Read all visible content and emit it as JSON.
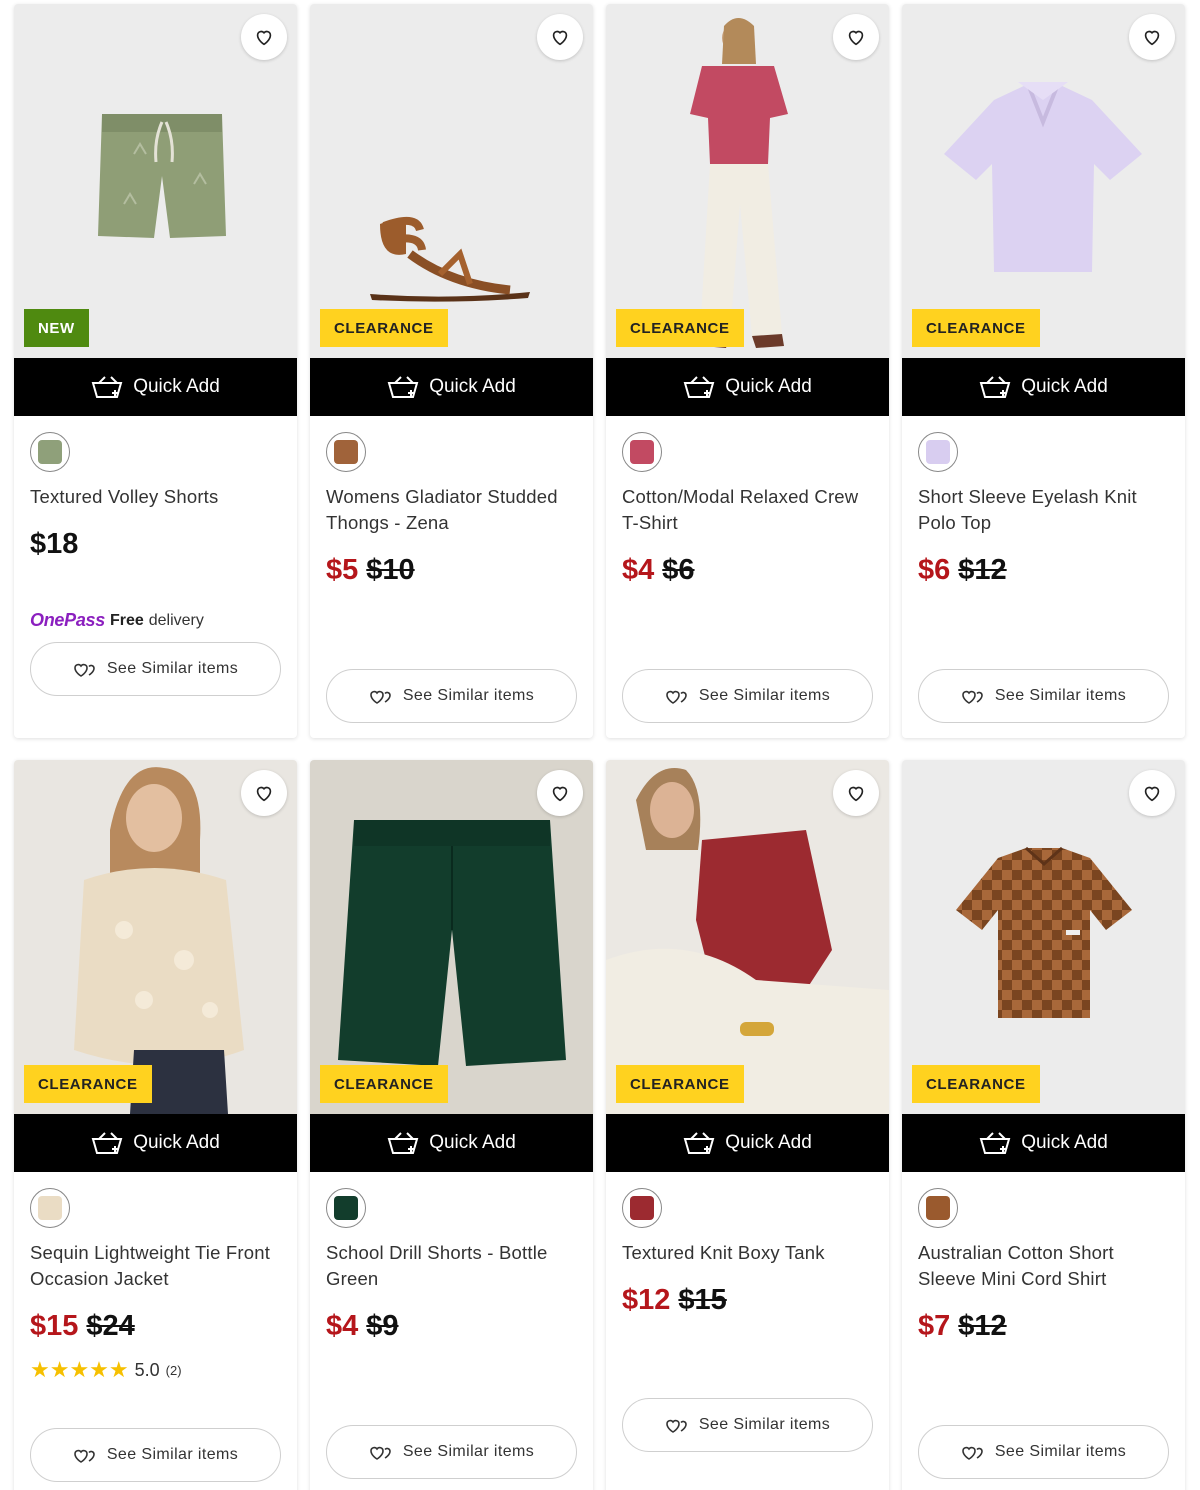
{
  "theme": {
    "sale_red": "#b5161b",
    "new_badge_bg": "#4f8a10",
    "clearance_badge_bg": "#ffd21f",
    "quick_add_bg": "#000000",
    "onepass_purple": "#8b1fbf",
    "star_color": "#f6c000"
  },
  "common": {
    "quick_add_label": "Quick Add",
    "see_similar_label": "See Similar items",
    "wishlist_icon": "heart-outline-icon",
    "quick_add_icon": "basket-plus-icon",
    "see_similar_icon": "hearts-icon"
  },
  "products": [
    {
      "title": "Textured Volley Shorts",
      "badge": "NEW",
      "price": "$18",
      "was_price": "",
      "swatch_color": "#8fa07a",
      "onepass": {
        "brand": "OnePass",
        "free": "Free",
        "delivery": "delivery"
      }
    },
    {
      "title": "Womens Gladiator Studded Thongs - Zena",
      "badge": "CLEARANCE",
      "price": "$5",
      "was_price": "$10",
      "swatch_color": "#a0633a"
    },
    {
      "title": "Cotton/Modal Relaxed Crew T-Shirt",
      "badge": "CLEARANCE",
      "price": "$4",
      "was_price": "$6",
      "swatch_color": "#c24a62"
    },
    {
      "title": "Short Sleeve Eyelash Knit Polo Top",
      "badge": "CLEARANCE",
      "price": "$6",
      "was_price": "$12",
      "swatch_color": "#d8cdf0"
    },
    {
      "title": "Sequin Lightweight Tie Front Occasion Jacket",
      "badge": "CLEARANCE",
      "price": "$15",
      "was_price": "$24",
      "swatch_color": "#eadcc4",
      "rating": {
        "stars": 5,
        "score": "5.0",
        "count": "(2)"
      }
    },
    {
      "title": "School Drill Shorts - Bottle Green",
      "badge": "CLEARANCE",
      "price": "$4",
      "was_price": "$9",
      "swatch_color": "#123d2c"
    },
    {
      "title": "Textured Knit Boxy Tank",
      "badge": "CLEARANCE",
      "price": "$12",
      "was_price": "$15",
      "swatch_color": "#9c2a30"
    },
    {
      "title": "Australian Cotton Short Sleeve Mini Cord Shirt",
      "badge": "CLEARANCE",
      "price": "$7",
      "was_price": "$12",
      "swatch_color": "#9a5a2e"
    }
  ]
}
